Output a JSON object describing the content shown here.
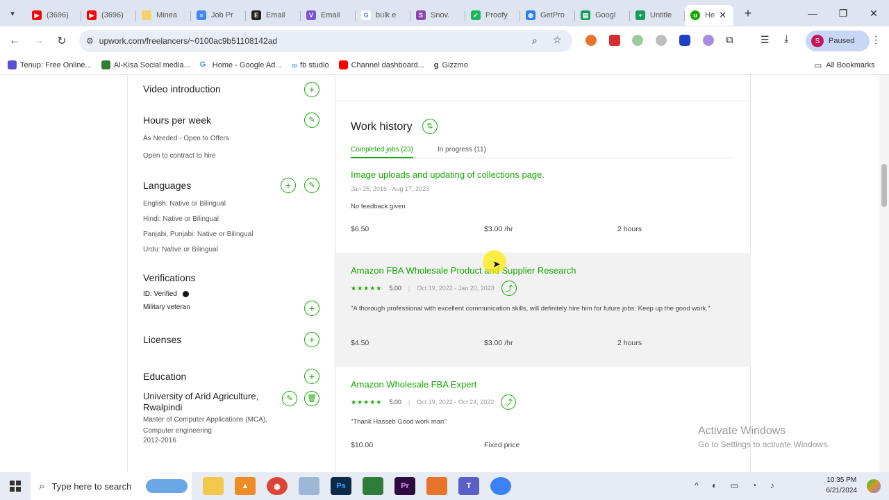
{
  "browser": {
    "tabs": [
      {
        "label": "(3696)",
        "favicon": "youtube-icon"
      },
      {
        "label": "(3696)",
        "favicon": "youtube-icon"
      },
      {
        "label": "Minea",
        "favicon": "minea-icon"
      },
      {
        "label": "Job Pr",
        "favicon": "docs-icon"
      },
      {
        "label": "Email",
        "favicon": "email-e-icon"
      },
      {
        "label": "Email",
        "favicon": "email-v-icon"
      },
      {
        "label": "bulk e",
        "favicon": "google-icon"
      },
      {
        "label": "Snov.",
        "favicon": "snov-icon"
      },
      {
        "label": "Proofy",
        "favicon": "proofy-icon"
      },
      {
        "label": "GetPro",
        "favicon": "globe-icon"
      },
      {
        "label": "Googl",
        "favicon": "sheets-icon"
      },
      {
        "label": "Untitle",
        "favicon": "sheets-plus-icon"
      }
    ],
    "active_tab": {
      "label": "He",
      "favicon": "upwork-icon"
    },
    "url": "upwork.com/freelancers/~0100ac9b51108142ad",
    "profile_initial": "S",
    "profile_status": "Paused",
    "bookmarks": [
      {
        "label": "Tenup: Free Online...",
        "color": "#5a4fcf"
      },
      {
        "label": "Al-Kisa Social media...",
        "color": "#2e7d32"
      },
      {
        "label": "Home - Google Ad...",
        "color": "#4285f4"
      },
      {
        "label": "fb studio",
        "color": "#1877f2"
      },
      {
        "label": "Channel dashboard...",
        "color": "#ff0000"
      },
      {
        "label": "Gizzmo",
        "color": "#333333"
      }
    ],
    "all_bookmarks": "All Bookmarks"
  },
  "sidebar": {
    "video_intro": "Video introduction",
    "hours_title": "Hours per week",
    "hours_value": "As Needed - Open to Offers",
    "contract_to_hire": "Open to contract to hire",
    "languages_title": "Languages",
    "languages": [
      "English: Native or Bilingual",
      "Hindi: Native or Bilingual",
      "Panjabi, Punjabi: Native or Bilingual",
      "Urdu: Native or Bilingual"
    ],
    "verifications_title": "Verifications",
    "id_verified": "ID: Verified",
    "military": "Military veteran",
    "licenses_title": "Licenses",
    "education_title": "Education",
    "education_school": "University of Arid Agriculture, Rwalpindi",
    "education_degree": "Master of Computer Applications (MCA), Computer engineering",
    "education_years": "2012-2016"
  },
  "work_history": {
    "title": "Work history",
    "tab_completed": "Completed jobs (23)",
    "tab_in_progress": "In progress (11)",
    "jobs": [
      {
        "title": "Image uploads and updating of collections page.",
        "dates": "Jan 25, 2016 - Aug 17, 2023",
        "rating": "",
        "feedback": "No feedback given",
        "earned": "$6.50",
        "rate": "$3.00 /hr",
        "hours": "2 hours"
      },
      {
        "title": "Amazon FBA Wholesale Product and Supplier Research",
        "dates": "Oct 19, 2022 - Jan 20, 2023",
        "rating": "5.00",
        "feedback": "\"A thorough professional with excellent communication skills, will definitely hire him for future jobs. Keep up the good work.\"",
        "earned": "$4.50",
        "rate": "$3.00 /hr",
        "hours": "2 hours"
      },
      {
        "title": "Amazon Wholesale FBA Expert",
        "dates": "Oct 19, 2022 - Oct 24, 2022",
        "rating": "5.00",
        "feedback": "\"Thank Hasseb Good work man\"",
        "earned": "$10.00",
        "rate": "Fixed price",
        "hours": ""
      }
    ]
  },
  "watermark": {
    "line1": "Activate Windows",
    "line2": "Go to Settings to activate Windows."
  },
  "taskbar": {
    "search_placeholder": "Type here to search",
    "time": "10:35 PM",
    "date": "6/21/2024"
  },
  "colors": {
    "accent": "#14a800",
    "tabbar": "#dfe5f0",
    "hover_row": "#f2f2f2"
  }
}
